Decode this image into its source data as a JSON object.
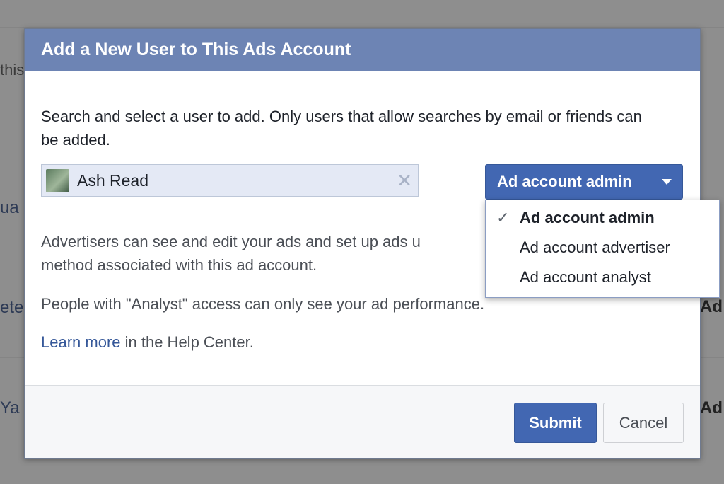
{
  "background": {
    "fragments": [
      "this",
      "ua",
      "ete",
      "Ya",
      "Ad a",
      "Ad a"
    ]
  },
  "dialog": {
    "title": "Add a New User to This Ads Account",
    "intro": "Search and select a user to add. Only users that allow searches by email or friends can be added.",
    "selected_user": {
      "name": "Ash Read",
      "avatar_icon": "user-avatar-photo",
      "remove_icon": "close-x-icon"
    },
    "role_select": {
      "selected": "Ad account admin",
      "caret_icon": "caret-down-icon"
    },
    "role_menu": {
      "check_glyph": "✓",
      "options": [
        "Ad account admin",
        "Ad account advertiser",
        "Ad account analyst"
      ]
    },
    "descriptions": {
      "advertisers_part1": "Advertisers can see and edit your ads and set up ads u",
      "advertisers_part2": "method associated with this ad account.",
      "analyst": "People with \"Analyst\" access can only see your ad performance.",
      "learn_more_link": "Learn more",
      "learn_more_suffix": " in the Help Center."
    },
    "footer": {
      "submit_label": "Submit",
      "cancel_label": "Cancel"
    }
  },
  "colors": {
    "header": "#6d84b4",
    "primary_button": "#4267b2",
    "link": "#365899",
    "overlay_bg": "#8e8e8e"
  }
}
